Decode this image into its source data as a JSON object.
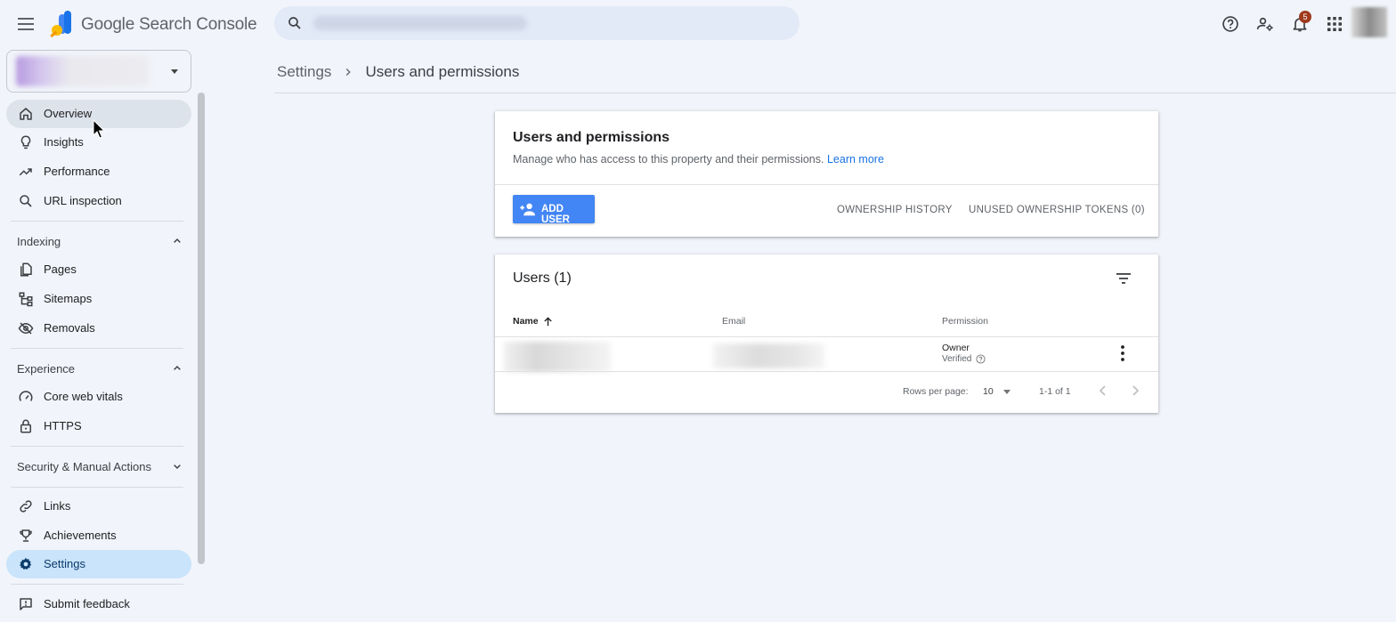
{
  "app": {
    "product_name": "Google Search Console",
    "notification_count": "5"
  },
  "breadcrumb": {
    "parent": "Settings",
    "current": "Users and permissions"
  },
  "sidebar": {
    "items_top": [
      {
        "label": "Overview",
        "icon": "home-icon"
      },
      {
        "label": "Insights",
        "icon": "lightbulb-icon"
      },
      {
        "label": "Performance",
        "icon": "trending-up-icon"
      },
      {
        "label": "URL inspection",
        "icon": "search-icon"
      }
    ],
    "indexing": {
      "label": "Indexing",
      "items": [
        {
          "label": "Pages",
          "icon": "pages-icon"
        },
        {
          "label": "Sitemaps",
          "icon": "sitemap-icon"
        },
        {
          "label": "Removals",
          "icon": "visibility-off-icon"
        }
      ]
    },
    "experience": {
      "label": "Experience",
      "items": [
        {
          "label": "Core web vitals",
          "icon": "speed-icon"
        },
        {
          "label": "HTTPS",
          "icon": "lock-icon"
        }
      ]
    },
    "security": {
      "label": "Security & Manual Actions"
    },
    "items_bottom": [
      {
        "label": "Links",
        "icon": "link-icon"
      },
      {
        "label": "Achievements",
        "icon": "trophy-icon"
      },
      {
        "label": "Settings",
        "icon": "gear-icon"
      }
    ],
    "feedback": {
      "label": "Submit feedback",
      "icon": "feedback-icon"
    }
  },
  "permissions_card": {
    "title": "Users and permissions",
    "description": "Manage who has access to this property and their permissions.",
    "learn_more": "Learn more",
    "add_user": "ADD USER",
    "ownership_history": "OWNERSHIP HISTORY",
    "unused_tokens": "UNUSED OWNERSHIP TOKENS (0)"
  },
  "users_card": {
    "title": "Users (1)",
    "columns": {
      "name": "Name",
      "email": "Email",
      "permission": "Permission"
    },
    "rows": [
      {
        "permission": "Owner",
        "status": "Verified"
      }
    ],
    "pagination": {
      "rows_per_page_label": "Rows per page:",
      "rows_per_page_value": "10",
      "range": "1-1 of 1"
    }
  },
  "colors": {
    "accent": "#4285f4",
    "selected_nav": "#c9e4fb",
    "background": "#f1f4fa"
  }
}
